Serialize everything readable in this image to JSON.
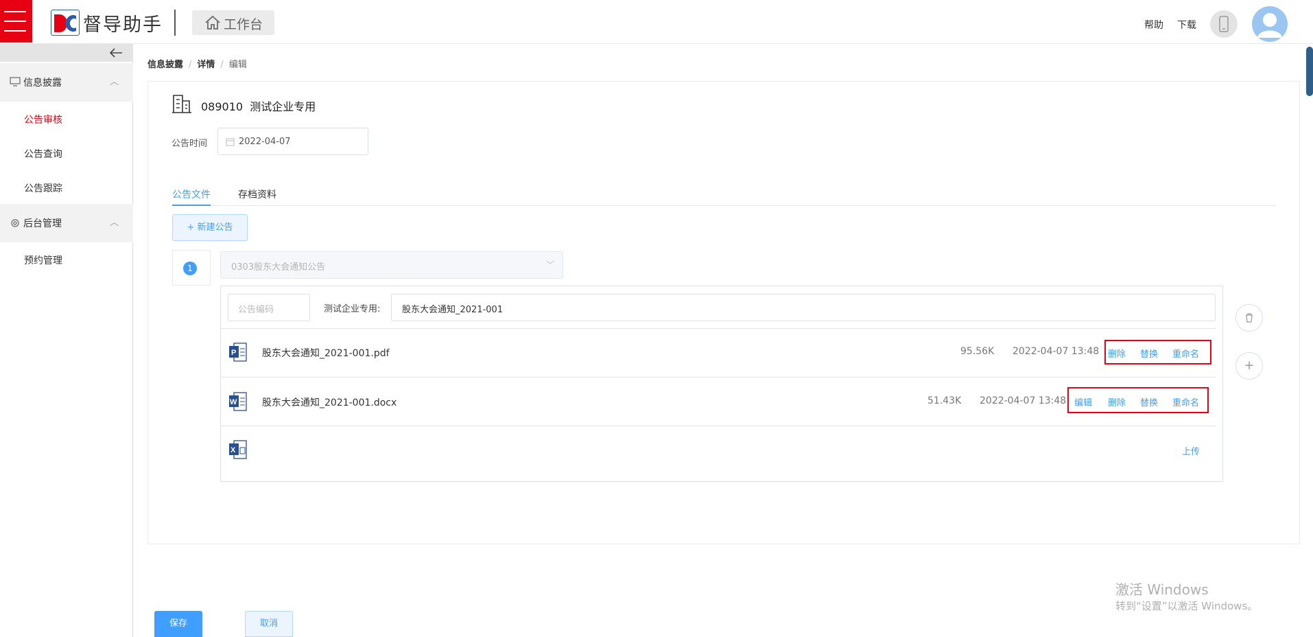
{
  "header": {
    "brand": "督导助手",
    "workbench_label": "工作台",
    "help_label": "帮助",
    "download_label": "下载",
    "brand_color": "#e60012",
    "logo_text": "DC"
  },
  "sidebar": {
    "groups": [
      {
        "label": "信息披露",
        "icon": "monitor-icon",
        "items": [
          "公告审核",
          "公告查询",
          "公告跟踪"
        ]
      },
      {
        "label": "后台管理",
        "icon": "gear-icon",
        "items": [
          "预约管理"
        ]
      }
    ],
    "active_item": "公告审核"
  },
  "breadcrumb": [
    "信息披露",
    "详情",
    "编辑"
  ],
  "company": {
    "code": "089010",
    "name": "测试企业专用"
  },
  "announce_time": {
    "label": "公告时间",
    "value": "2022-04-07"
  },
  "tabs": [
    {
      "label": "公告文件",
      "active": true
    },
    {
      "label": "存档资料",
      "active": false
    }
  ],
  "new_announcement_label": "+ 新建公告",
  "announcement": {
    "index": "1",
    "type_select": "0303股东大会通知公告",
    "code_placeholder": "公告编码",
    "name_prefix": "测试企业专用:",
    "name_value": "股东大会通知_2021-001",
    "files": [
      {
        "icon": "pdf-file-icon",
        "name": "股东大会通知_2021-001.pdf",
        "size": "95.56K",
        "time": "2022-04-07 13:48",
        "actions": [
          "删除",
          "替换",
          "重命名"
        ]
      },
      {
        "icon": "word-file-icon",
        "name": "股东大会通知_2021-001.docx",
        "size": "51.43K",
        "time": "2022-04-07 13:48",
        "actions": [
          "编辑",
          "删除",
          "替换",
          "重命名"
        ]
      },
      {
        "icon": "excel-file-icon",
        "name": "",
        "actions": [
          "上传"
        ]
      }
    ]
  },
  "footer": {
    "save_label": "保存",
    "cancel_label": "取消"
  },
  "watermark": {
    "line1": "激活 Windows",
    "line2": "转到“设置”以激活 Windows。"
  },
  "colors": {
    "accent": "#409eff",
    "highlight": "#e60012"
  }
}
